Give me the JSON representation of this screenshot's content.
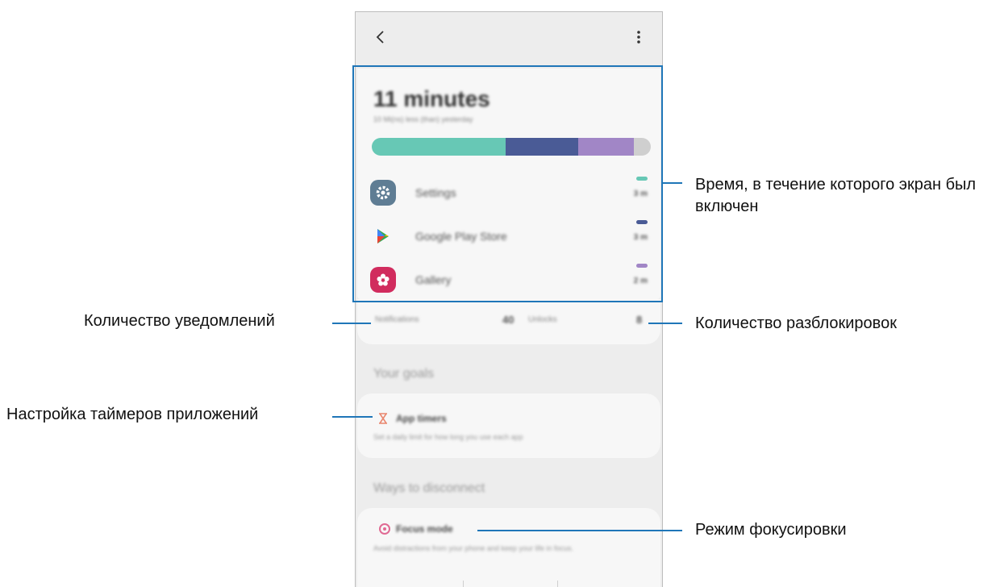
{
  "screen": {
    "total_time": "11 minutes",
    "compare_text": "10 Mi(ns) less (than) yesterday",
    "usage_segments": [
      {
        "name": "Settings",
        "fraction": 0.48,
        "color": "#67c8b5"
      },
      {
        "name": "Google Play Store",
        "fraction": 0.26,
        "color": "#4a5b96"
      },
      {
        "name": "Gallery",
        "fraction": 0.2,
        "color": "#a186c6"
      },
      {
        "name": "Other",
        "fraction": 0.06,
        "color": "#cfcfcf"
      }
    ],
    "apps": [
      {
        "name": "Settings",
        "time": "3 m",
        "icon": "settings-gear-icon",
        "color": "#67c8b5"
      },
      {
        "name": "Google Play Store",
        "time": "3 m",
        "icon": "play-store-icon",
        "color": "#4a5b96"
      },
      {
        "name": "Gallery",
        "time": "2 m",
        "icon": "gallery-flower-icon",
        "color": "#a186c6"
      }
    ],
    "notifications_label": "Notifications",
    "notifications_value": "40",
    "unlocks_label": "Unlocks",
    "unlocks_value": "8",
    "goals_title": "Your goals",
    "app_timers_title": "App timers",
    "app_timers_desc": "Set a daily limit for how long you use each app",
    "disconnect_title": "Ways to disconnect",
    "focus_title": "Focus mode",
    "focus_desc": "Avoid distractions from your phone and keep your life in focus."
  },
  "annotations": {
    "screen_time": "Время, в течение которого экран был включен",
    "notifications": "Количество уведомлений",
    "unlocks": "Количество разблокировок",
    "app_timers": "Настройка таймеров приложений",
    "focus_mode": "Режим фокусировки"
  },
  "colors": {
    "accent": "#1f76b8",
    "timer_icon": "#e9876f",
    "focus_icon": "#e06a93"
  }
}
